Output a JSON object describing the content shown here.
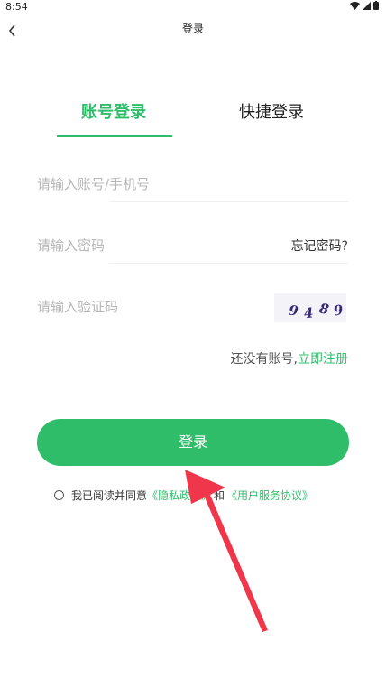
{
  "status_bar": {
    "time": "8:54"
  },
  "nav": {
    "title": "登录"
  },
  "tabs": [
    {
      "label": "账号登录",
      "active": true
    },
    {
      "label": "快捷登录",
      "active": false
    }
  ],
  "form": {
    "account_placeholder": "请输入账号/手机号",
    "password_placeholder": "请输入密码",
    "forgot_label": "忘记密码?",
    "captcha_placeholder": "请输入验证码",
    "captcha_digits": [
      "9",
      "4",
      "8",
      "9"
    ]
  },
  "register": {
    "prompt": "还没有账号,",
    "link": "立即注册"
  },
  "login_button": "登录",
  "agreement": {
    "prefix": "我已阅读并同意",
    "privacy_link": "《隐私政策》",
    "and": "和",
    "terms_link": "《用户服务协议》"
  },
  "colors": {
    "accent": "#2fbd6a",
    "arrow": "#f0364b"
  }
}
